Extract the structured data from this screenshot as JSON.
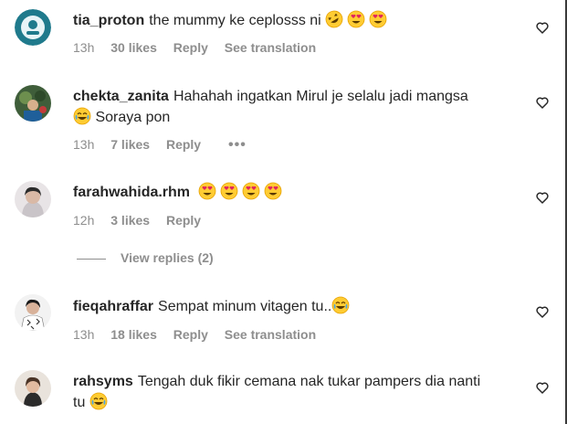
{
  "comments": [
    {
      "username": "tia_proton",
      "text": "the mummy ke ceplosss ni",
      "emojis": [
        "rofl",
        "heart-eyes",
        "heart-eyes"
      ],
      "time": "13h",
      "likes": "30 likes",
      "reply": "Reply",
      "translate": "See translation"
    },
    {
      "username": "chekta_zanita",
      "text": "Hahahah ingatkan Mirul je selalu jadi mangsa",
      "line2": "Soraya pon",
      "emojis": [
        "joy"
      ],
      "time": "13h",
      "likes": "7 likes",
      "reply": "Reply",
      "more": "•••"
    },
    {
      "username": "farahwahida.rhm",
      "text": "",
      "emojis": [
        "heart-eyes",
        "heart-eyes",
        "heart-eyes",
        "heart-eyes"
      ],
      "time": "12h",
      "likes": "3 likes",
      "reply": "Reply"
    },
    {
      "username": "fieqahraffar",
      "text": "Sempat minum vitagen tu..",
      "emojis": [
        "joy"
      ],
      "time": "13h",
      "likes": "18 likes",
      "reply": "Reply",
      "translate": "See translation"
    },
    {
      "username": "rahsyms",
      "text": "Tengah duk fikir cemana nak tukar pampers dia nanti",
      "line2": "tu",
      "emojis": [
        "joy"
      ]
    }
  ],
  "view_replies": "View replies (2)",
  "colors": {
    "text": "#262626",
    "muted": "#8e8e8e",
    "background": "#ffffff"
  }
}
